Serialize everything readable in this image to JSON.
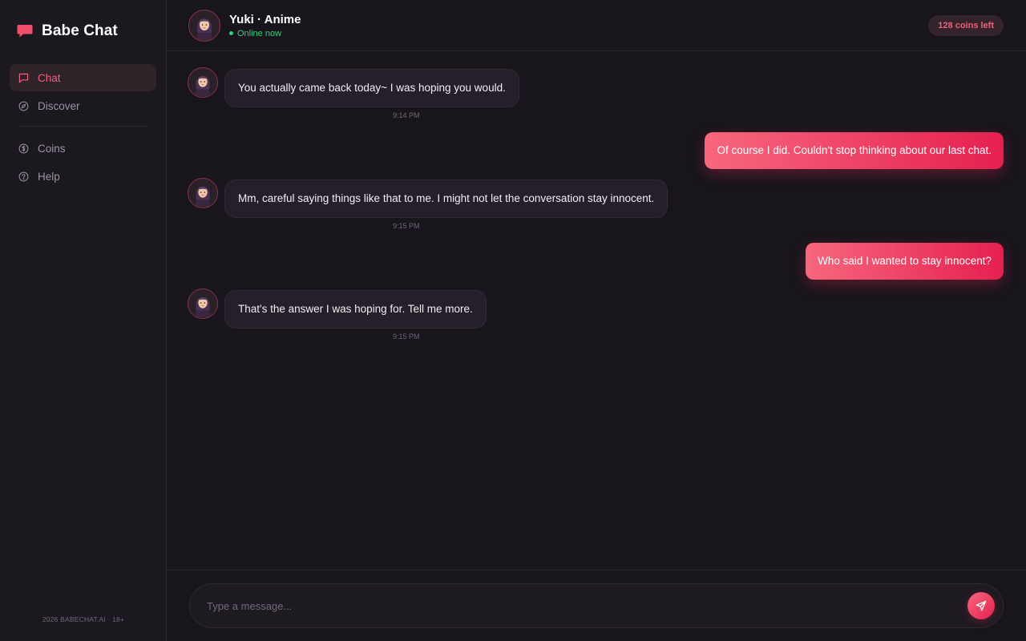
{
  "brand": {
    "name": "Babe Chat",
    "icon": "chat-bubble-icon",
    "accent": "#f0607a"
  },
  "sidebar": {
    "items": [
      {
        "label": "Chat",
        "icon": "message-square-icon",
        "active": true
      },
      {
        "label": "Discover",
        "icon": "compass-icon",
        "active": false
      },
      {
        "label": "Coins",
        "icon": "coin-icon",
        "active": false
      },
      {
        "label": "Help",
        "icon": "help-circle-icon",
        "active": false
      }
    ],
    "footer": "2026 BABECHAT.AI · 18+"
  },
  "header": {
    "name": "Yuki · Anime",
    "status": "Online now",
    "coins": "128 coins left"
  },
  "messages": [
    {
      "from": "bot",
      "text": "You actually came back today~ I was hoping you would.",
      "time": "9:14 PM"
    },
    {
      "from": "user",
      "text": "Of course I did. Couldn't stop thinking about our last chat."
    },
    {
      "from": "bot",
      "text": "Mm, careful saying things like that to me. I might not let the conversation stay innocent.",
      "time": "9:15 PM"
    },
    {
      "from": "user",
      "text": "Who said I wanted to stay innocent?"
    },
    {
      "from": "bot",
      "text": "That's the answer I was hoping for. Tell me more.",
      "time": "9:15 PM"
    }
  ],
  "composer": {
    "placeholder": "Type a message...",
    "send_icon": "send-icon"
  },
  "colors": {
    "online": "#34d17a",
    "bubble_user_start": "#f7677d",
    "bubble_user_end": "#e5204f",
    "background": "#18151c"
  }
}
